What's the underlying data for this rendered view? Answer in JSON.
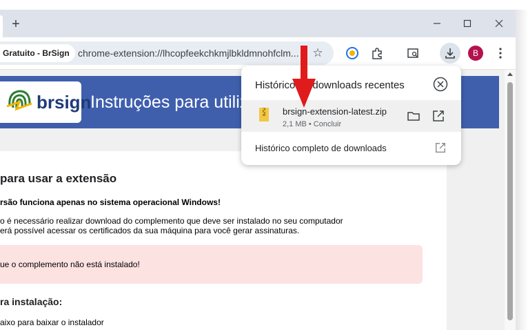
{
  "browser": {
    "new_tab_label": "+",
    "minimize_label": "–",
    "maximize_label": "▢",
    "close_label": "✕"
  },
  "toolbar": {
    "site_chip": "Gratuito - BrSign",
    "url": "chrome-extension://lhcopfeekchkmjlbkldmnohfclm...",
    "avatar_letter": "B",
    "accent": "#b3124e"
  },
  "page": {
    "logo_text": "brsign",
    "banner_title": "Instruções para utiliz",
    "heading": "para usar a extensão",
    "warning": "rsão funciona apenas no sistema operacional Windows!",
    "paragraph_line1": "o é necessário realizar download do complemento que deve ser instalado no seu computador",
    "paragraph_line2": "erá possível acessar os certificados da sua máquina para você gerar assinaturas.",
    "alert_text": "ue o complemento não está instalado!",
    "subheading": "ra instalação:",
    "instruction": "aixo para baixar o instalador"
  },
  "downloads_popup": {
    "title": "Histórico de downloads recentes",
    "item": {
      "filename": "brsign-extension-latest.zip",
      "meta": "2,1 MB • Concluir"
    },
    "full_history_label": "Histórico completo de downloads"
  },
  "icons": [
    "plus-icon",
    "minimize-icon",
    "maximize-icon",
    "close-icon",
    "star-icon",
    "extension-puzzle-icon",
    "search-tab-icon",
    "download-icon",
    "menu-dots-icon",
    "folder-icon",
    "open-external-icon",
    "zip-file-icon",
    "close-circle-icon",
    "red-arrow-annotation"
  ]
}
